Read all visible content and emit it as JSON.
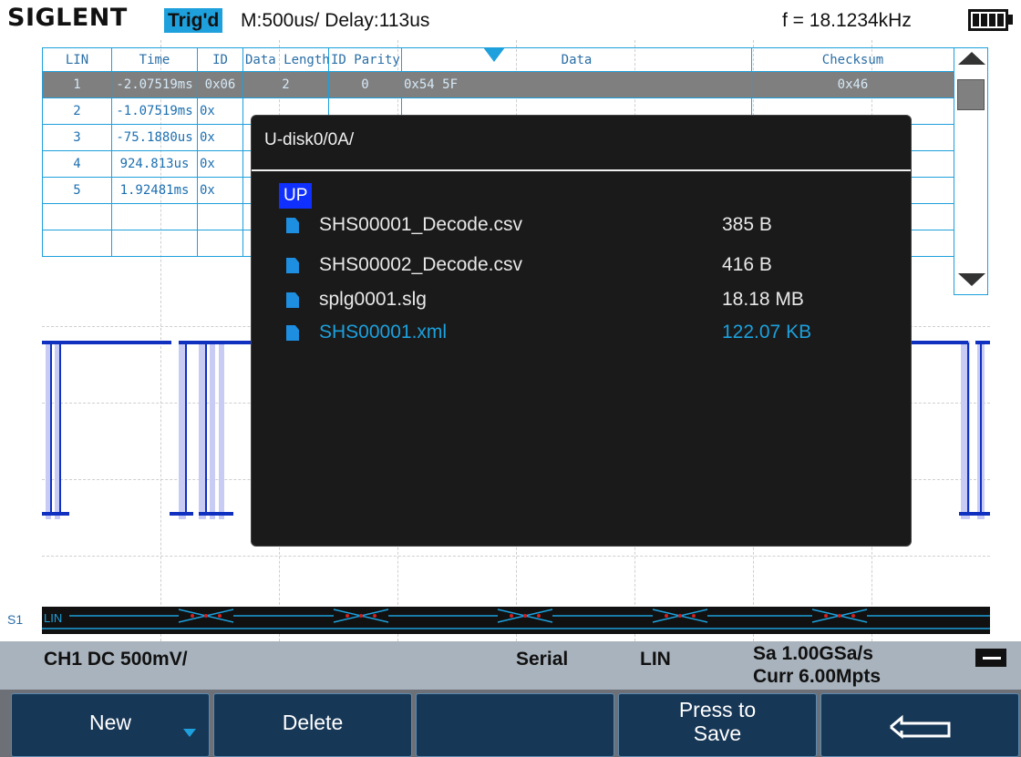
{
  "header": {
    "brand": "SIGLENT",
    "trig_status": "Trig'd",
    "timebase": "M:500us/ Delay:113us",
    "frequency": "f = 18.1234kHz"
  },
  "decode_table": {
    "columns": [
      "LIN",
      "Time",
      "ID",
      "Data Length",
      "ID Parity",
      "Data",
      "Checksum"
    ],
    "rows": [
      {
        "lin": "1",
        "time": "-2.07519ms",
        "id": "0x06",
        "length": "2",
        "parity": "0",
        "data": "0x54 5F",
        "checksum": "0x46"
      },
      {
        "lin": "2",
        "time": "-1.07519ms",
        "id": "0x",
        "length": "",
        "parity": "",
        "data": "",
        "checksum": ""
      },
      {
        "lin": "3",
        "time": "-75.1880us",
        "id": "0x",
        "length": "",
        "parity": "",
        "data": "",
        "checksum": ""
      },
      {
        "lin": "4",
        "time": "924.813us",
        "id": "0x",
        "length": "",
        "parity": "",
        "data": "",
        "checksum": ""
      },
      {
        "lin": "5",
        "time": "1.92481ms",
        "id": "0x",
        "length": "",
        "parity": "",
        "data": "",
        "checksum": ""
      },
      {
        "lin": "",
        "time": "",
        "id": "",
        "length": "",
        "parity": "",
        "data": "",
        "checksum": ""
      },
      {
        "lin": "",
        "time": "",
        "id": "",
        "length": "",
        "parity": "",
        "data": "",
        "checksum": ""
      }
    ]
  },
  "bus": {
    "label": "LIN",
    "channel_marker": "S1"
  },
  "dialog": {
    "path": "U-disk0/0A/",
    "up_label": "UP",
    "files": [
      {
        "name": "SHS00001_Decode.csv",
        "size": "385 B"
      },
      {
        "name": "SHS00002_Decode.csv",
        "size": "416 B"
      },
      {
        "name": "splg0001.slg",
        "size": "18.18 MB"
      },
      {
        "name": "SHS00001.xml",
        "size": "122.07 KB"
      }
    ]
  },
  "infobar": {
    "channel": "CH1 DC 500mV/",
    "mode": "Serial",
    "protocol": "LIN",
    "sample_rate": "Sa 1.00GSa/s",
    "memory": "Curr 6.00Mpts"
  },
  "softkeys": {
    "new": "New",
    "delete": "Delete",
    "save_line1": "Press to",
    "save_line2": "Save"
  },
  "colors": {
    "accent": "#1da0dc",
    "selection": "#1030ff",
    "dialog_bg": "#1a1a1a"
  }
}
